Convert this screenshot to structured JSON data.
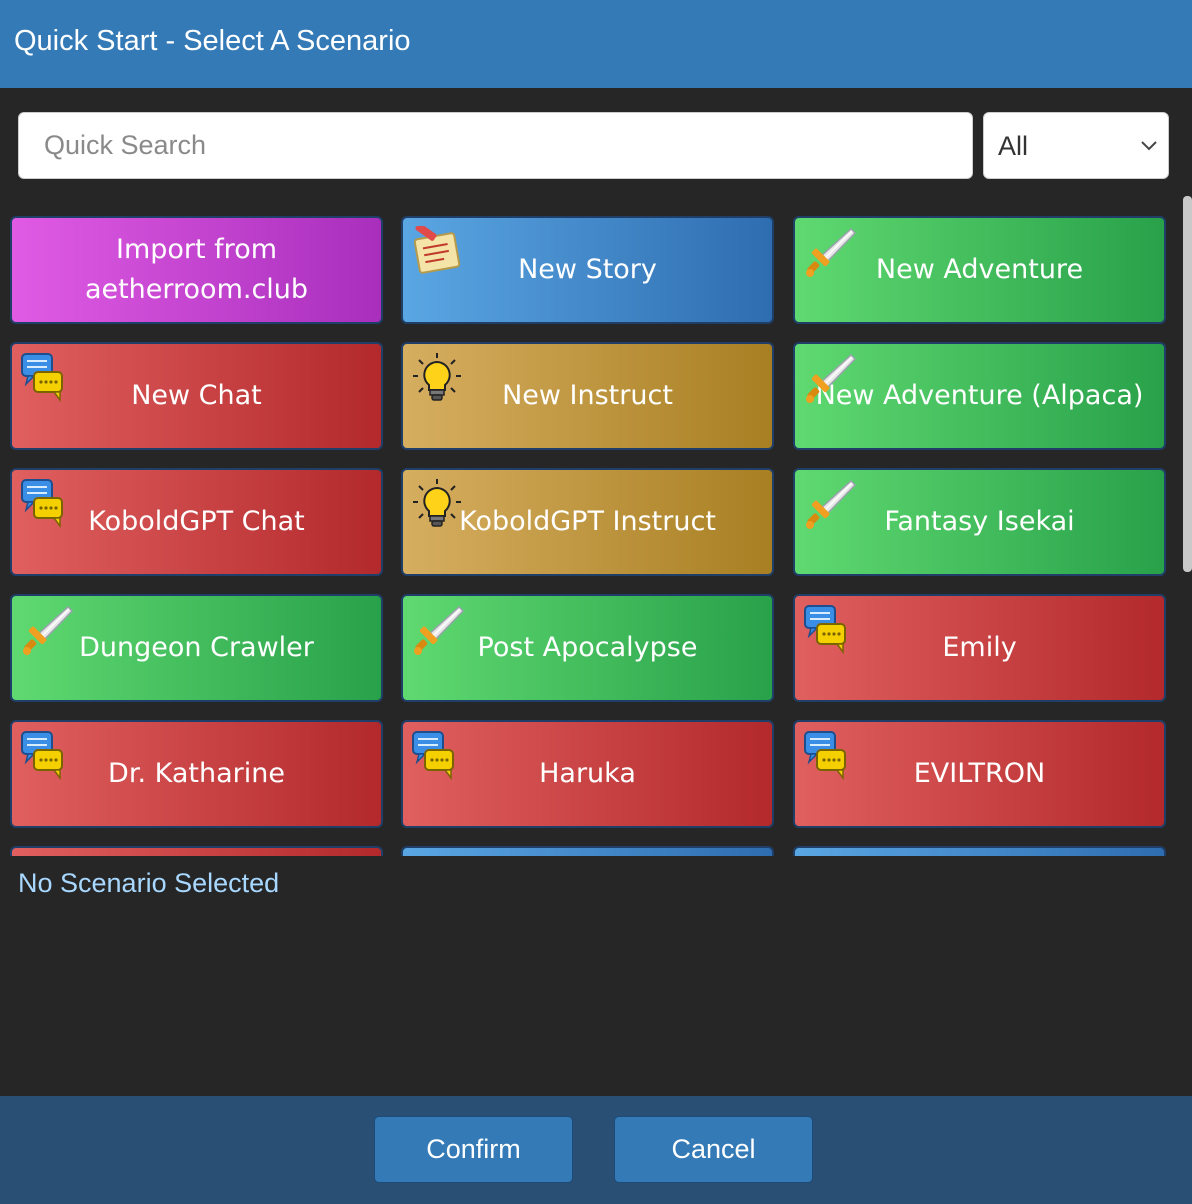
{
  "header": {
    "title": "Quick Start - Select A Scenario"
  },
  "search": {
    "placeholder": "Quick Search",
    "value": ""
  },
  "filter": {
    "selected": "All"
  },
  "scenarios": [
    {
      "label": "Import from aetherroom.club",
      "color": "purple",
      "icon": "none"
    },
    {
      "label": "New Story",
      "color": "blue",
      "icon": "notepad-icon"
    },
    {
      "label": "New Adventure",
      "color": "green",
      "icon": "sword-icon"
    },
    {
      "label": "New Chat",
      "color": "red",
      "icon": "chat-bubble-icon"
    },
    {
      "label": "New Instruct",
      "color": "gold",
      "icon": "lightbulb-icon"
    },
    {
      "label": "New Adventure (Alpaca)",
      "color": "green",
      "icon": "sword-icon"
    },
    {
      "label": "KoboldGPT Chat",
      "color": "red",
      "icon": "chat-bubble-icon"
    },
    {
      "label": "KoboldGPT Instruct",
      "color": "gold",
      "icon": "lightbulb-icon"
    },
    {
      "label": "Fantasy Isekai",
      "color": "green",
      "icon": "sword-icon"
    },
    {
      "label": "Dungeon Crawler",
      "color": "green",
      "icon": "sword-icon"
    },
    {
      "label": "Post Apocalypse",
      "color": "green",
      "icon": "sword-icon"
    },
    {
      "label": "Emily",
      "color": "red",
      "icon": "chat-bubble-icon"
    },
    {
      "label": "Dr. Katharine",
      "color": "red",
      "icon": "chat-bubble-icon"
    },
    {
      "label": "Haruka",
      "color": "red",
      "icon": "chat-bubble-icon"
    },
    {
      "label": "EVILTRON",
      "color": "red",
      "icon": "chat-bubble-icon"
    },
    {
      "label": "",
      "color": "red",
      "icon": "none"
    },
    {
      "label": "",
      "color": "blue",
      "icon": "none"
    },
    {
      "label": "",
      "color": "blue",
      "icon": "none"
    }
  ],
  "status": {
    "text": "No Scenario Selected"
  },
  "footer": {
    "confirm_label": "Confirm",
    "cancel_label": "Cancel"
  },
  "colors": {
    "header_bg": "#337ab7",
    "body_bg": "#262626",
    "footer_bg": "#2a4f74",
    "status_text": "#a8d8ff"
  }
}
